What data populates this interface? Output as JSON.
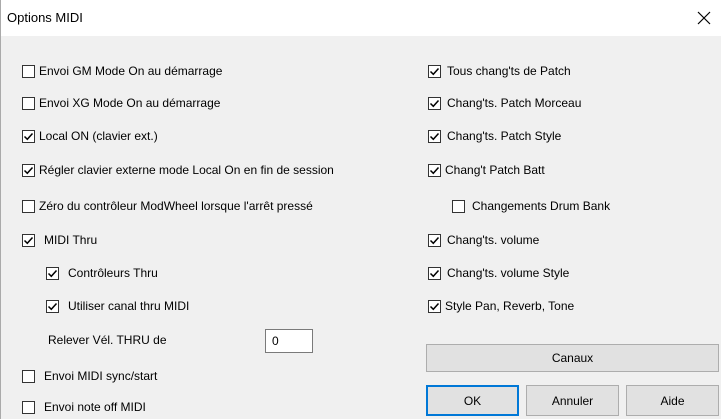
{
  "window": {
    "title": "Options MIDI",
    "close_label": "×"
  },
  "left_options": [
    {
      "label": "Envoi GM Mode On au démarrage",
      "checked": false
    },
    {
      "label": "Envoi XG Mode On au démarrage",
      "checked": false
    },
    {
      "label": "Local ON (clavier ext.)",
      "checked": true
    },
    {
      "label": "Régler clavier externe mode Local On en fin de session",
      "checked": true
    },
    {
      "label": "Zéro du contrôleur ModWheel lorsque l'arrêt pressé",
      "checked": false
    },
    {
      "label": "MIDI Thru",
      "checked": true
    },
    {
      "label": "Contrôleurs Thru",
      "checked": true
    },
    {
      "label": "Utiliser canal thru MIDI",
      "checked": true
    },
    {
      "label": "Envoi MIDI sync/start",
      "checked": false
    },
    {
      "label": "Envoi note off MIDI",
      "checked": false
    }
  ],
  "velocity": {
    "label": "Relever Vél. THRU de",
    "value": "0"
  },
  "right_options": [
    {
      "label": "Tous chang'ts de Patch",
      "checked": true
    },
    {
      "label": "Chang'ts. Patch Morceau",
      "checked": true
    },
    {
      "label": "Chang'ts. Patch Style",
      "checked": true
    },
    {
      "label": "Chang't Patch Batt",
      "checked": true
    },
    {
      "label": "Changements Drum Bank",
      "checked": false
    },
    {
      "label": "Chang'ts. volume",
      "checked": true
    },
    {
      "label": "Chang'ts. volume Style",
      "checked": true
    },
    {
      "label": "Style Pan, Reverb, Tone",
      "checked": true
    }
  ],
  "buttons": {
    "channels": "Canaux",
    "ok": "OK",
    "cancel": "Annuler",
    "help": "Aide"
  },
  "colors": {
    "dialog_bg": "#f0f0f0",
    "button_bg": "#e1e1e1",
    "default_button_border": "#0078d7"
  }
}
